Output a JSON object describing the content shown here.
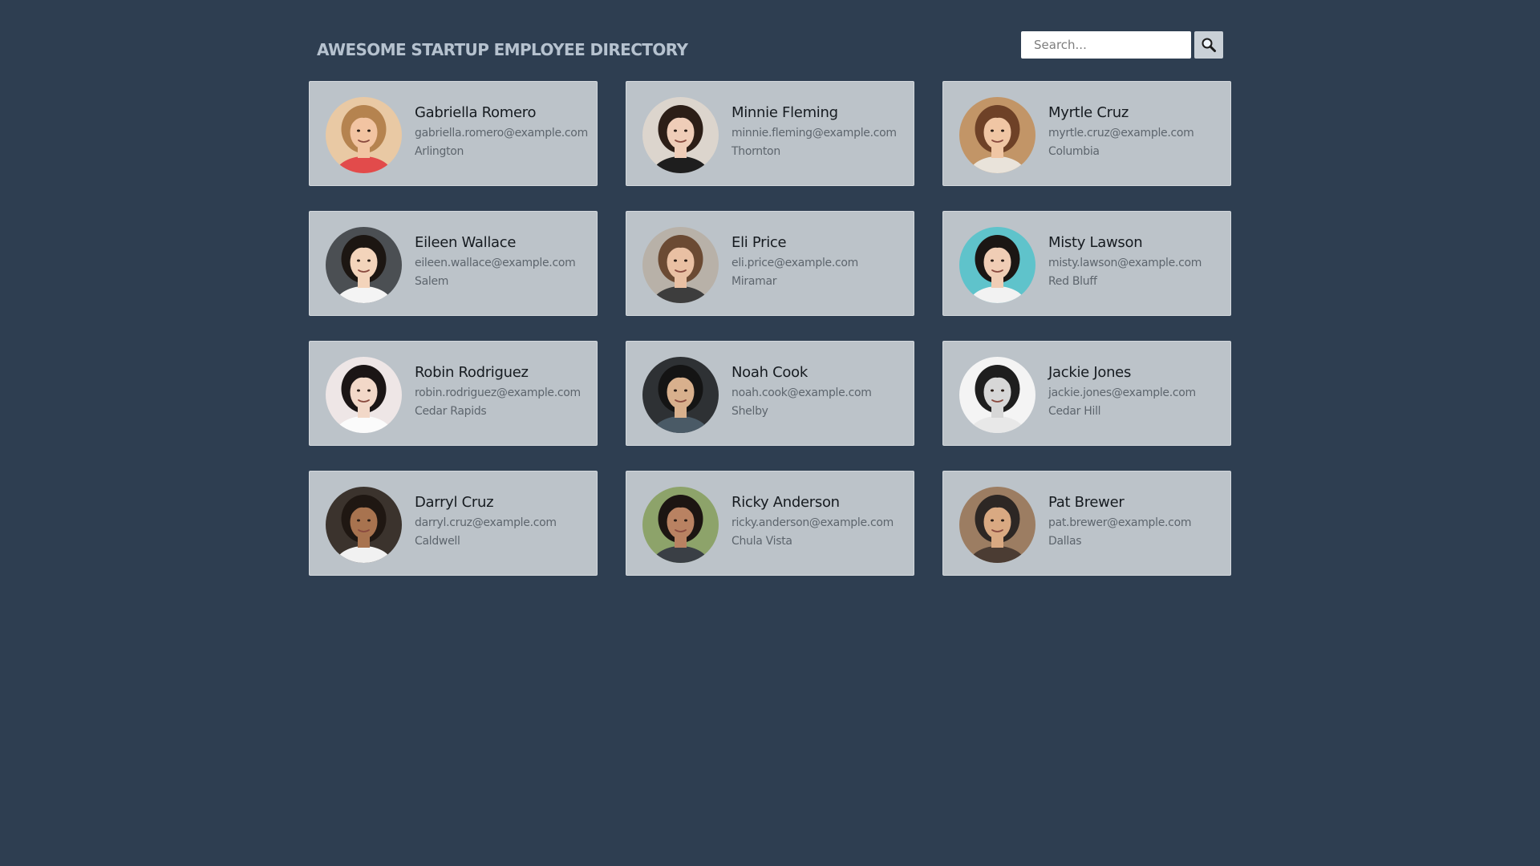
{
  "header": {
    "title": "AWESOME STARTUP EMPLOYEE DIRECTORY",
    "search_placeholder": "Search...",
    "search_icon": "search-icon"
  },
  "colors": {
    "background": "#2e3e51",
    "card": "#bcc3c9",
    "title": "#b6c2cf"
  },
  "employees": [
    {
      "name": "Gabriella Romero",
      "email": "gabriella.romero@example.com",
      "city": "Arlington"
    },
    {
      "name": "Minnie Fleming",
      "email": "minnie.fleming@example.com",
      "city": "Thornton"
    },
    {
      "name": "Myrtle Cruz",
      "email": "myrtle.cruz@example.com",
      "city": "Columbia"
    },
    {
      "name": "Eileen Wallace",
      "email": "eileen.wallace@example.com",
      "city": "Salem"
    },
    {
      "name": "Eli Price",
      "email": "eli.price@example.com",
      "city": "Miramar"
    },
    {
      "name": "Misty Lawson",
      "email": "misty.lawson@example.com",
      "city": "Red Bluff"
    },
    {
      "name": "Robin Rodriguez",
      "email": "robin.rodriguez@example.com",
      "city": "Cedar Rapids"
    },
    {
      "name": "Noah Cook",
      "email": "noah.cook@example.com",
      "city": "Shelby"
    },
    {
      "name": "Jackie Jones",
      "email": "jackie.jones@example.com",
      "city": "Cedar Hill"
    },
    {
      "name": "Darryl Cruz",
      "email": "darryl.cruz@example.com",
      "city": "Caldwell"
    },
    {
      "name": "Ricky Anderson",
      "email": "ricky.anderson@example.com",
      "city": "Chula Vista"
    },
    {
      "name": "Pat Brewer",
      "email": "pat.brewer@example.com",
      "city": "Dallas"
    }
  ]
}
